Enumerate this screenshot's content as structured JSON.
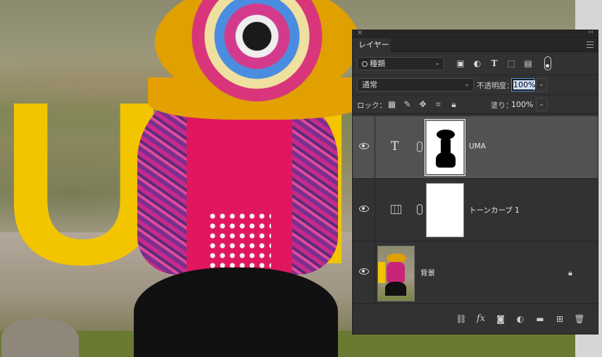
{
  "canvas": {
    "letters": "UMA",
    "letter_color": "#f2c500"
  },
  "panel": {
    "tab_label": "レイヤー",
    "filter": {
      "value": "種類",
      "icons": [
        "image-filter-icon",
        "adjustment-filter-icon",
        "type-filter-icon",
        "shape-filter-icon",
        "smart-object-filter-icon"
      ]
    },
    "blend_mode": "通常",
    "opacity_label": "不透明度：",
    "opacity_value": "100%",
    "lock_label": "ロック：",
    "fill_label": "塗り：",
    "fill_value": "100%",
    "accent_color": "#4d8de0"
  },
  "layers": [
    {
      "name": "UMA",
      "kind": "type",
      "selected": true,
      "visible": true
    },
    {
      "name": "トーンカーブ 1",
      "kind": "curves-adjustment",
      "selected": false,
      "visible": true
    },
    {
      "name": "背景",
      "kind": "background",
      "selected": false,
      "visible": true,
      "locked": true
    }
  ],
  "bottom_icons": [
    "link-layers-icon",
    "fx-icon",
    "add-mask-icon",
    "adjustment-layer-icon",
    "new-group-icon",
    "new-layer-icon",
    "trash-icon"
  ]
}
